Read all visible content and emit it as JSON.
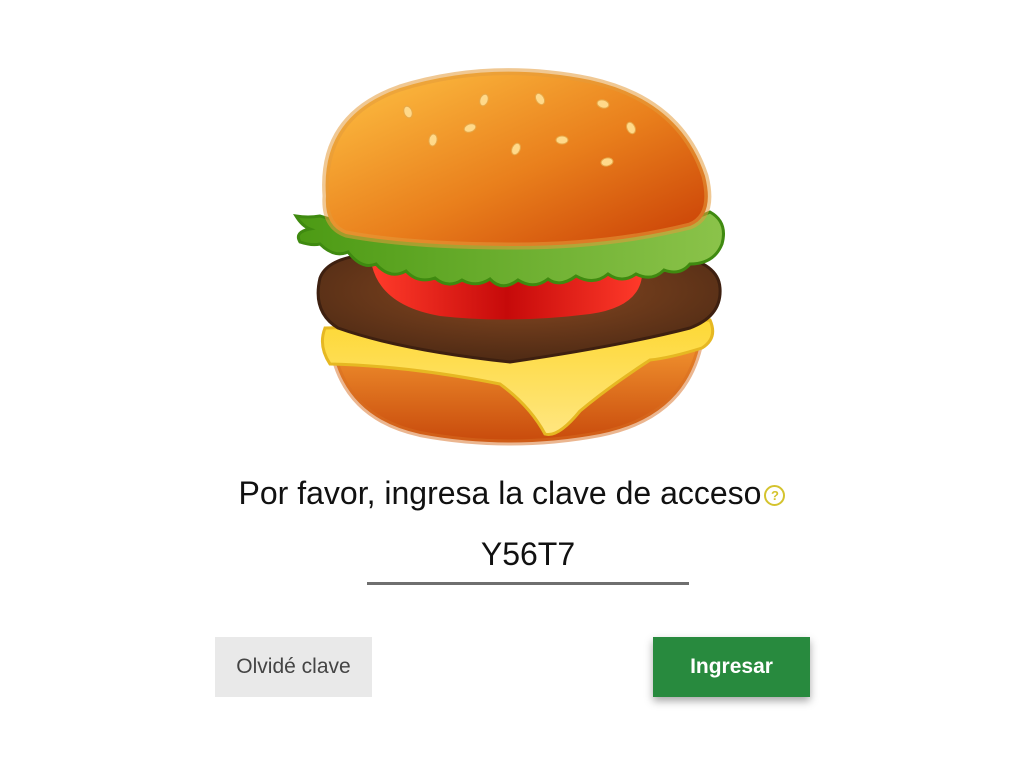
{
  "prompt": {
    "text": "Por favor, ingresa la clave de acceso",
    "help_icon_glyph": "?",
    "help_icon": "help-circle-icon"
  },
  "passcode": {
    "value": "Y56T7"
  },
  "buttons": {
    "forgot_label": "Olvidé clave",
    "enter_label": "Ingresar"
  },
  "image": {
    "icon": "hamburger-illustration"
  },
  "colors": {
    "primary": "#288a3e",
    "secondary_bg": "#e9e9e9",
    "help_icon": "#d4c32e",
    "underline": "#6f6f6f"
  }
}
